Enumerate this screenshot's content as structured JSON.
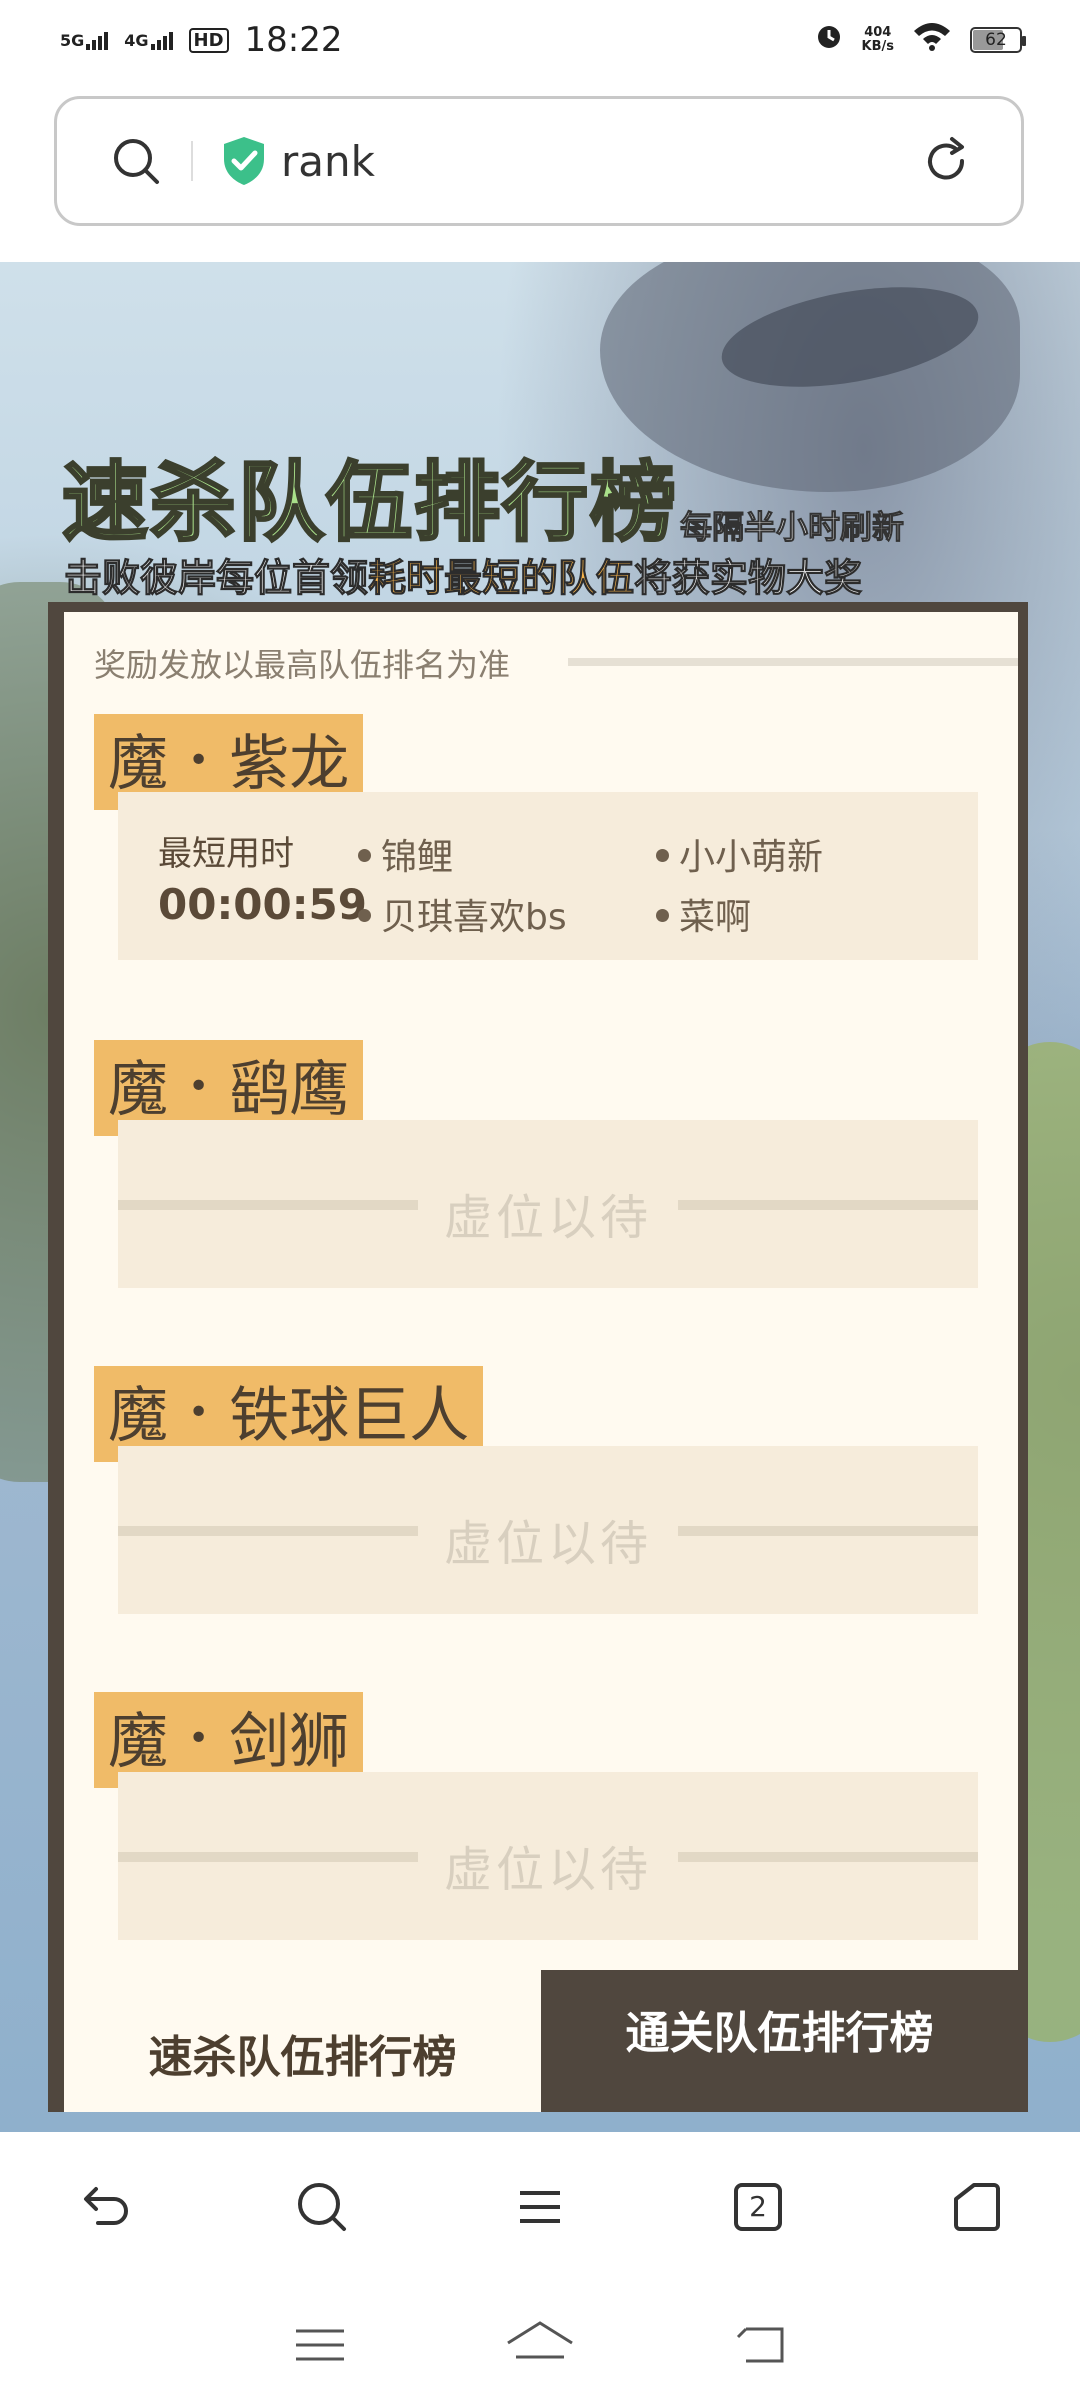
{
  "status_bar": {
    "network1": "5G",
    "network2": "4G",
    "hd": "HD",
    "time": "18:22",
    "speed_value": "404",
    "speed_unit": "KB/s",
    "battery": "62"
  },
  "address_bar": {
    "url_text": "rank",
    "icons": [
      "search-icon",
      "shield-check-icon",
      "reload-icon"
    ]
  },
  "page": {
    "title": "速杀队伍排行榜",
    "refresh_tag": "每隔半小时刷新",
    "subtitle_pre": "击败彼岸每位首领",
    "subtitle_highlight": "耗时最短的队伍",
    "subtitle_post": "将获实物大奖",
    "note": "奖励发放以最高队伍排名为准",
    "bosses": [
      {
        "prefix": "魔",
        "separator": "•",
        "name": "紫龙",
        "record_label": "最短用时",
        "record_time": "00:00:59",
        "members": [
          "锦鲤",
          "小小萌新",
          "贝琪喜欢bs",
          "菜啊"
        ]
      },
      {
        "prefix": "魔",
        "separator": "•",
        "name": "鹞鹰",
        "empty_text": "虚位以待"
      },
      {
        "prefix": "魔",
        "separator": "•",
        "name": "铁球巨人",
        "empty_text": "虚位以待"
      },
      {
        "prefix": "魔",
        "separator": "•",
        "name": "剑狮",
        "empty_text": "虚位以待"
      }
    ],
    "tabs": [
      {
        "label": "速杀队伍排行榜",
        "active": true
      },
      {
        "label": "通关队伍排行榜",
        "active": false
      }
    ],
    "colors": {
      "title_green": "#a9e08a",
      "highlight_orange": "#f6b34a",
      "boss_tag": "#f0bb68",
      "panel_dark": "#50473e",
      "card_bg": "#fffaf0"
    }
  },
  "toolbar": {
    "tab_count": "2",
    "icons": [
      "back-icon",
      "search-icon",
      "menu-icon",
      "tabs-icon",
      "home-icon"
    ]
  },
  "system_nav": {
    "icons": [
      "recent-apps-icon",
      "home-icon",
      "back-icon"
    ]
  }
}
